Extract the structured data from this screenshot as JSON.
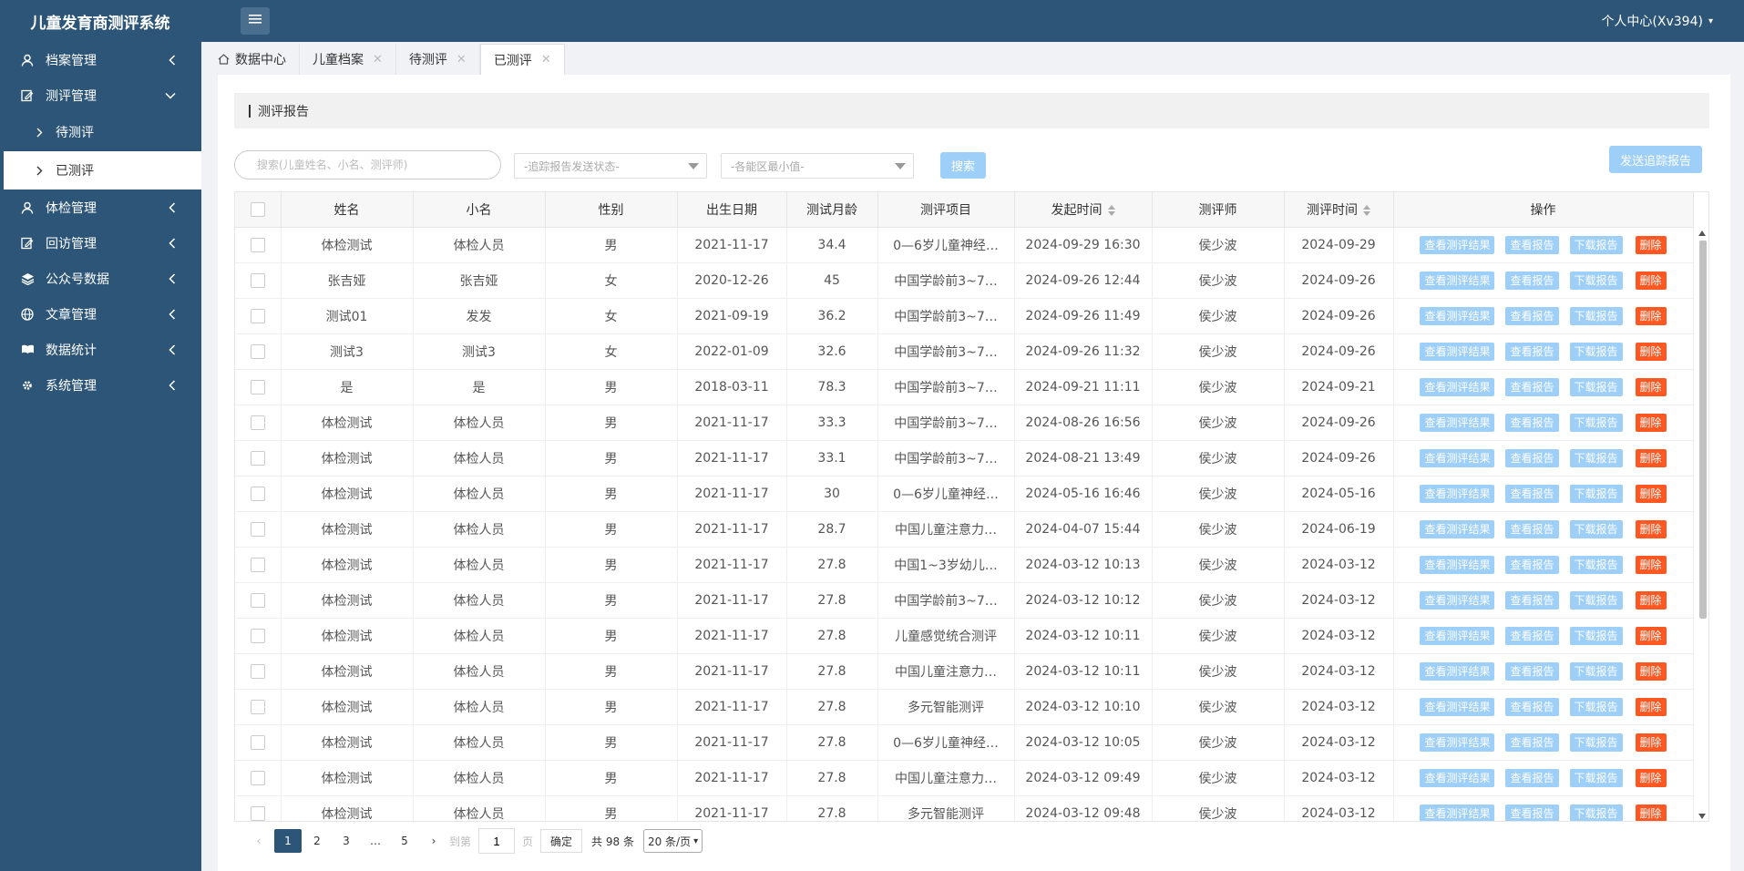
{
  "app": {
    "title": "儿童发育商测评系统",
    "user_center": "个人中心(Xv394)"
  },
  "sidebar": {
    "items": [
      {
        "label": "档案管理",
        "icon": "user-icon",
        "expanded": false
      },
      {
        "label": "测评管理",
        "icon": "edit-icon",
        "expanded": true
      },
      {
        "label": "体检管理",
        "icon": "user-icon",
        "expanded": false
      },
      {
        "label": "回访管理",
        "icon": "edit-icon",
        "expanded": false
      },
      {
        "label": "公众号数据",
        "icon": "layers-icon",
        "expanded": false
      },
      {
        "label": "文章管理",
        "icon": "globe-icon",
        "expanded": false
      },
      {
        "label": "数据统计",
        "icon": "book-icon",
        "expanded": false
      },
      {
        "label": "系统管理",
        "icon": "gear-icon",
        "expanded": false
      }
    ],
    "subitems": [
      {
        "label": "待测评",
        "active": false
      },
      {
        "label": "已测评",
        "active": true
      }
    ]
  },
  "tabs": [
    {
      "label": "数据中心",
      "closable": false
    },
    {
      "label": "儿童档案",
      "closable": true
    },
    {
      "label": "待测评",
      "closable": true
    },
    {
      "label": "已测评",
      "closable": true,
      "active": true
    }
  ],
  "section": {
    "title": "测评报告"
  },
  "filters": {
    "search_placeholder": "搜索(儿童姓名、小名、测评师)",
    "status_select": "-追踪报告发送状态-",
    "min_select": "-各能区最小值-",
    "search_button": "搜索",
    "send_button": "发送追踪报告"
  },
  "table": {
    "columns": [
      "姓名",
      "小名",
      "性别",
      "出生日期",
      "测试月龄",
      "测评项目",
      "发起时间",
      "测评师",
      "测评时间",
      "操作"
    ],
    "sortable_columns": [
      "发起时间",
      "测评时间"
    ],
    "actions": [
      "查看测评结果",
      "查看报告",
      "下载报告",
      "删除"
    ],
    "rows": [
      [
        "体检测试",
        "体检人员",
        "男",
        "2021-11-17",
        "34.4",
        "0—6岁儿童神经…",
        "2024-09-29 16:30",
        "侯少波",
        "2024-09-29"
      ],
      [
        "张吉娅",
        "张吉娅",
        "女",
        "2020-12-26",
        "45",
        "中国学龄前3~7…",
        "2024-09-26 12:44",
        "侯少波",
        "2024-09-26"
      ],
      [
        "测试01",
        "发发",
        "女",
        "2021-09-19",
        "36.2",
        "中国学龄前3~7…",
        "2024-09-26 11:49",
        "侯少波",
        "2024-09-26"
      ],
      [
        "测试3",
        "测试3",
        "女",
        "2022-01-09",
        "32.6",
        "中国学龄前3~7…",
        "2024-09-26 11:32",
        "侯少波",
        "2024-09-26"
      ],
      [
        "是",
        "是",
        "男",
        "2018-03-11",
        "78.3",
        "中国学龄前3~7…",
        "2024-09-21 11:11",
        "侯少波",
        "2024-09-21"
      ],
      [
        "体检测试",
        "体检人员",
        "男",
        "2021-11-17",
        "33.3",
        "中国学龄前3~7…",
        "2024-08-26 16:56",
        "侯少波",
        "2024-09-26"
      ],
      [
        "体检测试",
        "体检人员",
        "男",
        "2021-11-17",
        "33.1",
        "中国学龄前3~7…",
        "2024-08-21 13:49",
        "侯少波",
        "2024-09-26"
      ],
      [
        "体检测试",
        "体检人员",
        "男",
        "2021-11-17",
        "30",
        "0—6岁儿童神经…",
        "2024-05-16 16:46",
        "侯少波",
        "2024-05-16"
      ],
      [
        "体检测试",
        "体检人员",
        "男",
        "2021-11-17",
        "28.7",
        "中国儿童注意力…",
        "2024-04-07 15:44",
        "侯少波",
        "2024-06-19"
      ],
      [
        "体检测试",
        "体检人员",
        "男",
        "2021-11-17",
        "27.8",
        "中国1~3岁幼儿…",
        "2024-03-12 10:13",
        "侯少波",
        "2024-03-12"
      ],
      [
        "体检测试",
        "体检人员",
        "男",
        "2021-11-17",
        "27.8",
        "中国学龄前3~7…",
        "2024-03-12 10:12",
        "侯少波",
        "2024-03-12"
      ],
      [
        "体检测试",
        "体检人员",
        "男",
        "2021-11-17",
        "27.8",
        "儿童感觉统合测评",
        "2024-03-12 10:11",
        "侯少波",
        "2024-03-12"
      ],
      [
        "体检测试",
        "体检人员",
        "男",
        "2021-11-17",
        "27.8",
        "中国儿童注意力…",
        "2024-03-12 10:11",
        "侯少波",
        "2024-03-12"
      ],
      [
        "体检测试",
        "体检人员",
        "男",
        "2021-11-17",
        "27.8",
        "多元智能测评",
        "2024-03-12 10:10",
        "侯少波",
        "2024-03-12"
      ],
      [
        "体检测试",
        "体检人员",
        "男",
        "2021-11-17",
        "27.8",
        "0—6岁儿童神经…",
        "2024-03-12 10:05",
        "侯少波",
        "2024-03-12"
      ],
      [
        "体检测试",
        "体检人员",
        "男",
        "2021-11-17",
        "27.8",
        "中国儿童注意力…",
        "2024-03-12 09:49",
        "侯少波",
        "2024-03-12"
      ],
      [
        "体检测试",
        "体检人员",
        "男",
        "2021-11-17",
        "27.8",
        "多元智能测评",
        "2024-03-12 09:48",
        "侯少波",
        "2024-03-12"
      ]
    ]
  },
  "pagination": {
    "prev": "‹",
    "pages": [
      "1",
      "2",
      "3",
      "…",
      "5"
    ],
    "current": "1",
    "next": "›",
    "goto_label": "到第",
    "goto_value": "1",
    "page_unit": "页",
    "confirm": "确定",
    "total": "共 98 条",
    "per_page": "20 条/页"
  },
  "colors": {
    "primary": "#2c5577",
    "button_light": "#9ecff8",
    "danger": "#ff5722"
  }
}
